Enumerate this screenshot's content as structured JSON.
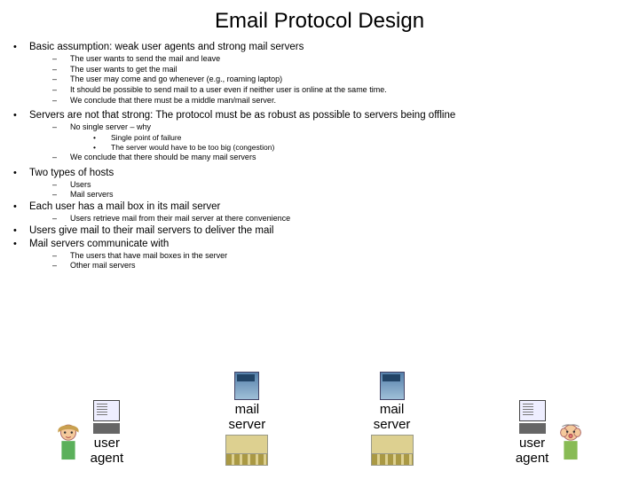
{
  "title": "Email Protocol Design",
  "b1": "Basic assumption: weak user agents and strong mail servers",
  "b1a": "The user wants to send the mail and leave",
  "b1b": "The user wants to get the mail",
  "b1c": "The user may come and go whenever (e.g., roaming laptop)",
  "b1d": "It should be possible to send mail to a user even if neither user is online at the same time.",
  "b1e": "We conclude that there must be a middle man/mail server.",
  "b2": "Servers are not that strong: The protocol must be as robust as possible to servers being offline",
  "b2a": "No single server – why",
  "b2a1": "Single point of failure",
  "b2a2": "The server would have to be too big (congestion)",
  "b2b": "We conclude that there should be many mail servers",
  "b3": "Two types of hosts",
  "b3a": "Users",
  "b3b": "Mail servers",
  "b4": "Each user has a mail box in its mail server",
  "b4a": "Users retrieve mail from their mail server at there convenience",
  "b5": "Users give mail to their mail servers to deliver the mail",
  "b6": "Mail servers communicate with",
  "b6a": "The users that have mail boxes in the server",
  "b6b": "Other mail servers",
  "labels": {
    "userAgent": "user\nagent",
    "mailServer": "mail\nserver"
  }
}
